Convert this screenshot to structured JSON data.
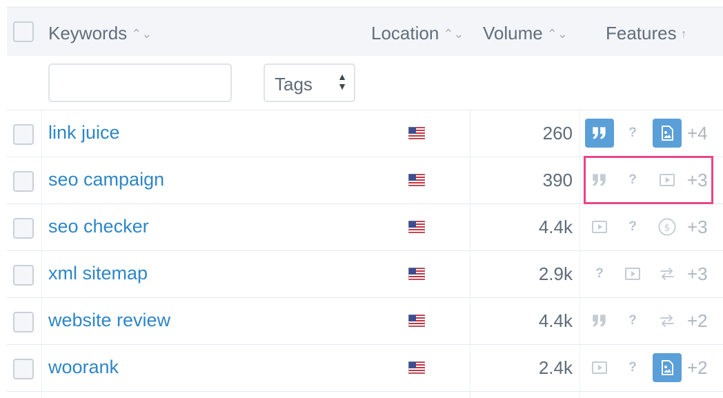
{
  "header": {
    "keywords_label": "Keywords",
    "location_label": "Location",
    "volume_label": "Volume",
    "features_label": "Features",
    "sort_neutral_icon": "⌃⌄",
    "sort_up_icon": "↑"
  },
  "filters": {
    "keyword_value": "",
    "keyword_placeholder": "",
    "tags_label": "Tags"
  },
  "rows": [
    {
      "keyword": "link juice",
      "location": "us-flag-icon",
      "volume": "260",
      "more": "+4"
    },
    {
      "keyword": "seo campaign",
      "location": "us-flag-icon",
      "volume": "390",
      "more": "+3"
    },
    {
      "keyword": "seo checker",
      "location": "us-flag-icon",
      "volume": "4.4k",
      "more": "+3"
    },
    {
      "keyword": "xml sitemap",
      "location": "us-flag-icon",
      "volume": "2.9k",
      "more": "+3"
    },
    {
      "keyword": "website review",
      "location": "us-flag-icon",
      "volume": "4.4k",
      "more": "+2"
    },
    {
      "keyword": "woorank",
      "location": "us-flag-icon",
      "volume": "2.4k",
      "more": "+2"
    }
  ],
  "feature_glyph": "?",
  "colors": {
    "link": "#2d86c7",
    "active_feature": "#5a9fd8",
    "highlight": "#e84587"
  }
}
